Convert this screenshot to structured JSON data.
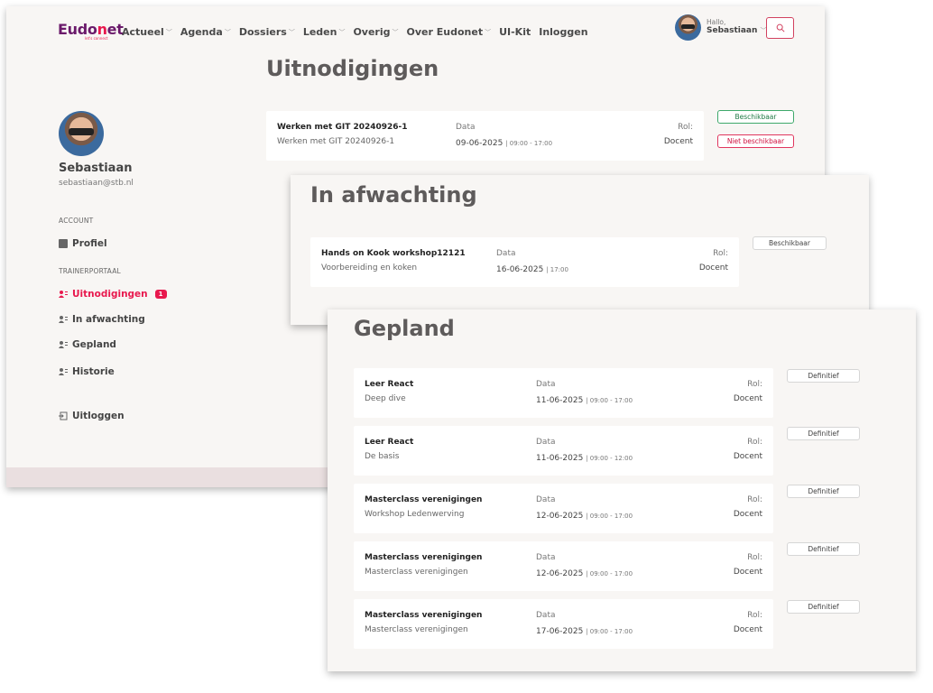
{
  "header": {
    "logo_main": "Eudo",
    "logo_accent": "n",
    "logo_end": "et",
    "logo_tagline": "let's connect",
    "nav": [
      {
        "label": "Actueel",
        "dropdown": true
      },
      {
        "label": "Agenda",
        "dropdown": true
      },
      {
        "label": "Dossiers",
        "dropdown": true
      },
      {
        "label": "Leden",
        "dropdown": true
      },
      {
        "label": "Overig",
        "dropdown": true
      },
      {
        "label": "Over Eudonet",
        "dropdown": true
      },
      {
        "label": "UI-Kit",
        "dropdown": false
      },
      {
        "label": "Inloggen",
        "dropdown": false
      }
    ],
    "greeting": "Hallo,",
    "user": "Sebastiaan"
  },
  "page_title": "Uitnodigingen",
  "sidebar": {
    "name": "Sebastiaan",
    "email": "sebastiaan@stb.nl",
    "account_label": "ACCOUNT",
    "profile": "Profiel",
    "portal_label": "TRAINERPORTAAL",
    "items": [
      {
        "label": "Uitnodigingen",
        "badge": "1",
        "active": true
      },
      {
        "label": "In afwachting"
      },
      {
        "label": "Gepland"
      },
      {
        "label": "Historie"
      }
    ],
    "logout": "Uitloggen"
  },
  "invitations": [
    {
      "title": "Werken met GIT 20240926-1",
      "subtitle": "Werken met GIT 20240926-1",
      "date_label": "Data",
      "date": "09-06-2025",
      "time": "| 09:00 - 17:00",
      "role_label": "Rol:",
      "role": "Docent",
      "accept_label": "Beschikbaar",
      "decline_label": "Niet beschikbaar"
    }
  ],
  "pending": {
    "title": "In afwachting",
    "items": [
      {
        "title": "Hands on Kook workshop12121",
        "subtitle": "Voorbereiding en koken",
        "date_label": "Data",
        "date": "16-06-2025",
        "time": "| 17:00",
        "role_label": "Rol:",
        "role": "Docent",
        "status": "Beschikbaar"
      }
    ]
  },
  "planned": {
    "title": "Gepland",
    "items": [
      {
        "title": "Leer React",
        "subtitle": "Deep dive",
        "date_label": "Data",
        "date": "11-06-2025",
        "time": "| 09:00 - 17:00",
        "role_label": "Rol:",
        "role": "Docent",
        "status": "Definitief"
      },
      {
        "title": "Leer React",
        "subtitle": "De basis",
        "date_label": "Data",
        "date": "11-06-2025",
        "time": "| 09:00 - 12:00",
        "role_label": "Rol:",
        "role": "Docent",
        "status": "Definitief"
      },
      {
        "title": "Masterclass verenigingen",
        "subtitle": "Workshop Ledenwerving",
        "date_label": "Data",
        "date": "12-06-2025",
        "time": "| 09:00 - 17:00",
        "role_label": "Rol:",
        "role": "Docent",
        "status": "Definitief"
      },
      {
        "title": "Masterclass verenigingen",
        "subtitle": "Masterclass verenigingen",
        "date_label": "Data",
        "date": "12-06-2025",
        "time": "| 09:00 - 17:00",
        "role_label": "Rol:",
        "role": "Docent",
        "status": "Definitief"
      },
      {
        "title": "Masterclass verenigingen",
        "subtitle": "Masterclass verenigingen",
        "date_label": "Data",
        "date": "17-06-2025",
        "time": "| 09:00 - 17:00",
        "role_label": "Rol:",
        "role": "Docent",
        "status": "Definitief"
      }
    ]
  },
  "colors": {
    "accent": "#e8194e",
    "brand": "#6b1a6b",
    "success": "#3ea86b"
  }
}
